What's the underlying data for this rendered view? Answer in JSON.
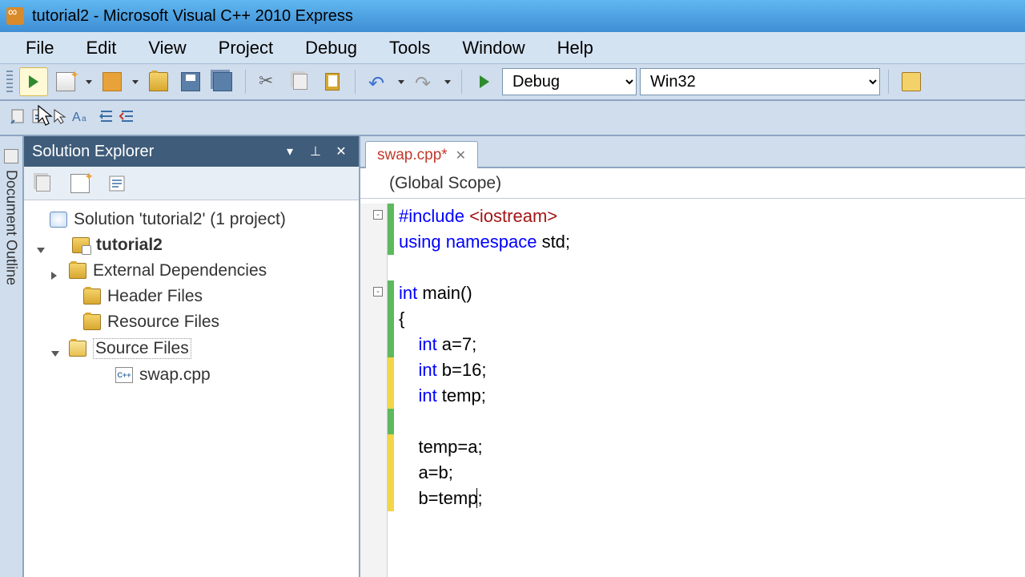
{
  "title": "tutorial2 - Microsoft Visual C++ 2010 Express",
  "menu": {
    "file": "File",
    "edit": "Edit",
    "view": "View",
    "project": "Project",
    "debug": "Debug",
    "tools": "Tools",
    "window": "Window",
    "help": "Help"
  },
  "toolbar": {
    "config": "Debug",
    "platform": "Win32"
  },
  "doc_outline_label": "Document Outline",
  "solution_explorer": {
    "title": "Solution Explorer",
    "root": "Solution 'tutorial2' (1 project)",
    "project": "tutorial2",
    "folders": {
      "external": "External Dependencies",
      "header": "Header Files",
      "resource": "Resource Files",
      "source": "Source Files"
    },
    "files": {
      "swap": "swap.cpp"
    }
  },
  "editor": {
    "tab": "swap.cpp*",
    "scope": "(Global Scope)",
    "lines": {
      "l1a": "#include",
      "l1b": " <iostream>",
      "l2a": "using",
      "l2b": " namespace",
      "l2c": " std;",
      "l3": "",
      "l4a": "int",
      "l4b": " main()",
      "l5": "{",
      "l6a": "    int",
      "l6b": " a=7;",
      "l7a": "    int",
      "l7b": " b=16;",
      "l8a": "    int",
      "l8b": " temp;",
      "l9": "",
      "l10": "    temp=a;",
      "l11": "    a=b;",
      "l12": "    b=temp;",
      "l12_caret_before": "    b=temp",
      "l12_after": ";"
    }
  }
}
